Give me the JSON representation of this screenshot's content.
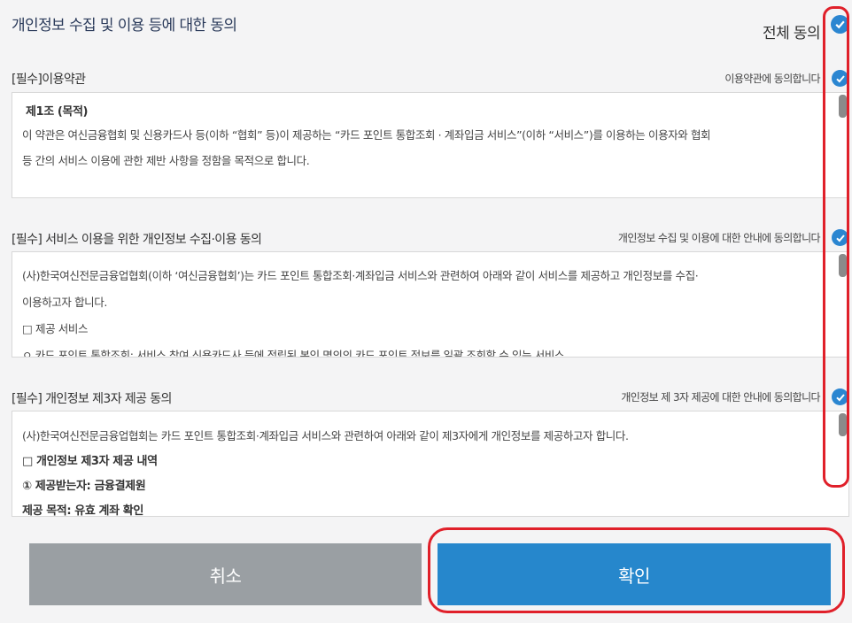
{
  "header": {
    "title": "개인정보 수집 및 이용 등에 대한 동의",
    "agree_all_label": "전체 동의"
  },
  "sections": [
    {
      "title": "[필수]이용약관",
      "agree_label": "이용약관에 동의합니다",
      "lines": [
        "제1조 (목적)",
        "이 약관은 여신금융협회 및 신용카드사 등(이하 “협회” 등)이 제공하는 “카드 포인트 통합조회 · 계좌입금 서비스”(이하 “서비스”)를 이용하는 이용자와 협회",
        "등 간의 서비스 이용에 관한 제반 사항을 정함을 목적으로 합니다."
      ]
    },
    {
      "title": "[필수] 서비스 이용을 위한 개인정보 수집·이용 동의",
      "agree_label": "개인정보 수집 및 이용에 대한 안내에 동의합니다",
      "lines": [
        "(사)한국여신전문금융업협회(이하 ‘여신금융협회’)는 카드 포인트 통합조회·계좌입금 서비스와 관련하여 아래와 같이 서비스를 제공하고 개인정보를 수집·",
        "이용하고자 합니다.",
        "□ 제공 서비스",
        "ㅇ 카드 포인트 통합조회: 서비스 참여 신용카드사 등에 적립된 본인 명의의 카드 포인트 정보를 일괄 조회할 수 있는 서비스"
      ]
    },
    {
      "title": "[필수] 개인정보 제3자 제공 동의",
      "agree_label": "개인정보 제 3자 제공에 대한 안내에 동의합니다",
      "lines": [
        "(사)한국여신전문금융업협회는 카드 포인트 통합조회·계좌입금 서비스와 관련하여 아래와 같이 제3자에게 개인정보를 제공하고자 합니다.",
        "□ 개인정보 제3자 제공 내역",
        "① 제공받는자: 금융결제원",
        "제공 목적: 유효 계좌 확인"
      ]
    }
  ],
  "buttons": {
    "cancel": "취소",
    "confirm": "확인"
  },
  "icons": {
    "check": "check-circle-icon"
  },
  "colors": {
    "accent": "#2687cc",
    "check": "#2b86d1",
    "cancel": "#9a9fa3",
    "highlight": "#e0202a"
  }
}
